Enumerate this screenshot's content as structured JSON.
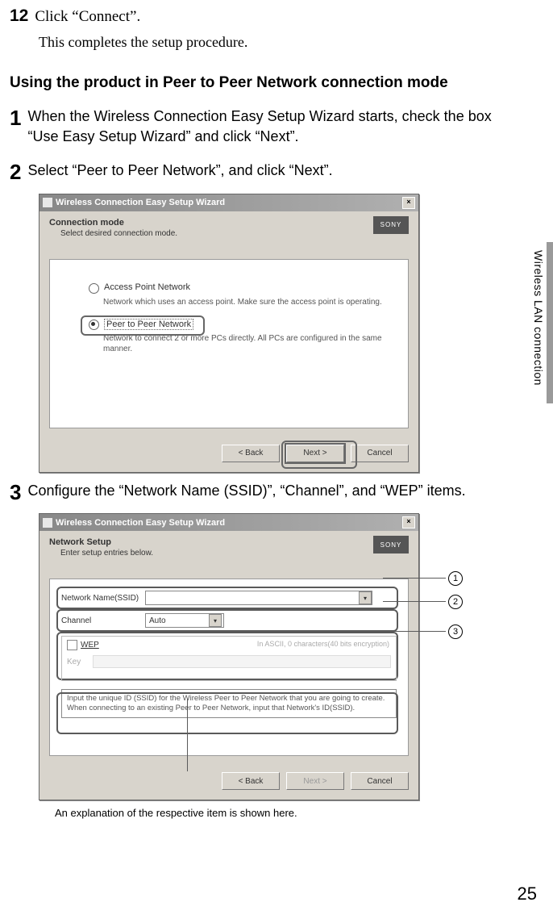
{
  "step12": {
    "num": "12",
    "text": "Click “Connect”.",
    "sub": "This completes the setup procedure."
  },
  "section_head": "Using the product in Peer to Peer Network connection mode",
  "step1": {
    "num": "1",
    "text": "When the Wireless Connection Easy Setup Wizard starts, check the box “Use Easy Setup Wizard” and click “Next”."
  },
  "step2": {
    "num": "2",
    "text": "Select “Peer to Peer Network”, and click “Next”."
  },
  "step3": {
    "num": "3",
    "text": "Configure the “Network Name (SSID)”, “Channel”, and “WEP” items."
  },
  "dialog1": {
    "title": "Wireless Connection Easy Setup Wizard",
    "close": "×",
    "head": "Connection mode",
    "sub": "Select desired connection mode.",
    "brand": "SONY",
    "opt1_label": "Access Point Network",
    "opt1_desc": "Network which uses an access point. Make sure the access point is operating.",
    "opt2_label": "Peer to Peer Network",
    "opt2_desc": "Network to connect 2 or more PCs directly. All PCs are configured in the same manner.",
    "back": "< Back",
    "next": "Next >",
    "cancel": "Cancel"
  },
  "dialog2": {
    "title": "Wireless Connection Easy Setup Wizard",
    "close": "×",
    "head": "Network Setup",
    "sub": "Enter setup entries below.",
    "brand": "SONY",
    "ssid_label": "Network Name(SSID)",
    "channel_label": "Channel",
    "channel_value": "Auto",
    "wep_label": "WEP",
    "wep_hint": "In ASCII, 0 characters(40 bits encryption)",
    "key_label": "Key",
    "info": "Input the unique ID (SSID) for the Wireless Peer to Peer Network that you are going to create. When connecting to an existing Peer to Peer Network, input that Network's ID(SSID).",
    "back": "< Back",
    "next": "Next >",
    "cancel": "Cancel"
  },
  "callout_nums": {
    "c1": "1",
    "c2": "2",
    "c3": "3"
  },
  "caption": "An explanation of the respective item is shown here.",
  "sidebar": "Wireless LAN connection",
  "page_number": "25"
}
